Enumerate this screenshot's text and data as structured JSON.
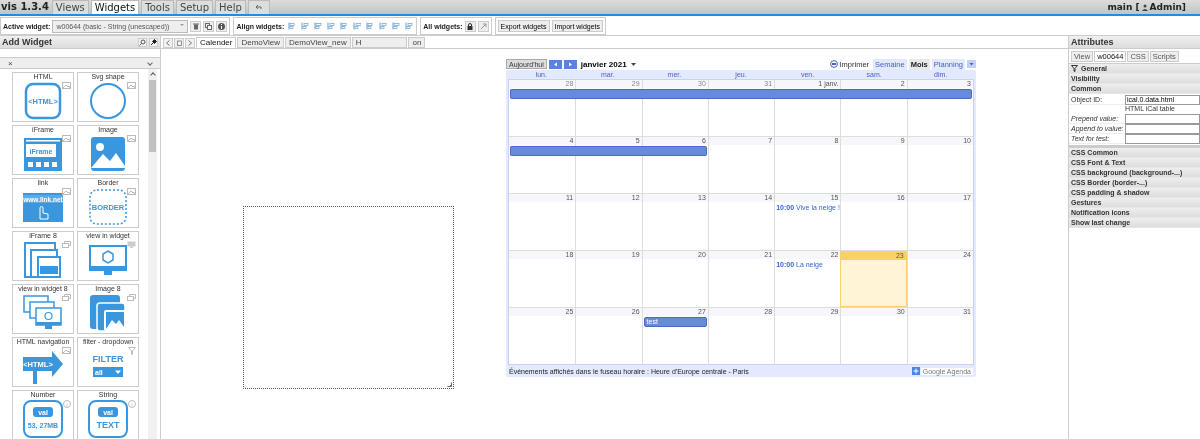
{
  "menubar": {
    "app_title": "vis 1.3.4",
    "menus": [
      {
        "label": "Views",
        "selected": false
      },
      {
        "label": "Widgets",
        "selected": true
      },
      {
        "label": "Tools",
        "selected": false
      },
      {
        "label": "Setup",
        "selected": false
      },
      {
        "label": "Help",
        "selected": false
      }
    ],
    "user_prefix": "main [",
    "user_name": "Admin]"
  },
  "toolbar": {
    "active_widget_label": "Active widget:",
    "active_widget": "w00644 (basic - String (unescaped))",
    "align_label": "Align widgets:",
    "all_label": "All widgets:",
    "buttons": [
      "Export widgets",
      "Import widgets"
    ]
  },
  "widget_panel": {
    "title": "Add Widget",
    "filter_clear": "×",
    "widgets": [
      {
        "name": "HTML",
        "kind": "html",
        "icon_texts": [
          "<HTML>"
        ]
      },
      {
        "name": "Svg shape",
        "kind": "svg"
      },
      {
        "name": "iFrame",
        "kind": "iframe",
        "icon_texts": [
          "iFrame"
        ]
      },
      {
        "name": "Image",
        "kind": "image"
      },
      {
        "name": "link",
        "kind": "link",
        "icon_texts": [
          "www.link.net"
        ]
      },
      {
        "name": "Border",
        "kind": "border",
        "icon_texts": [
          "BORDER"
        ]
      },
      {
        "name": "iFrame 8",
        "kind": "iframe8"
      },
      {
        "name": "view in widget",
        "kind": "view"
      },
      {
        "name": "view in widget 8",
        "kind": "view8"
      },
      {
        "name": "Image 8",
        "kind": "image8"
      },
      {
        "name": "HTML navigation",
        "kind": "navigation",
        "icon_texts": [
          "<HTML>"
        ]
      },
      {
        "name": "filter - dropdown",
        "kind": "filter",
        "icon_texts": [
          "FILTER",
          "all"
        ]
      },
      {
        "name": "Number",
        "kind": "number",
        "icon_texts": [
          "val",
          "53, 27MB"
        ]
      },
      {
        "name": "String",
        "kind": "string",
        "icon_texts": [
          "val",
          "TEXT"
        ]
      }
    ]
  },
  "view_tabs": [
    {
      "label": "Calender",
      "selected": true
    },
    {
      "label": "DemoView",
      "selected": false
    },
    {
      "label": "DemoView_new",
      "selected": false
    },
    {
      "label": "H",
      "selected": false
    },
    {
      "label": "on",
      "selected": false
    }
  ],
  "calendar": {
    "today_button": "Aujourd'hui",
    "month": "janvier 2021",
    "print": "Imprimer",
    "views": [
      {
        "label": "Semaine",
        "selected": false
      },
      {
        "label": "Mois",
        "selected": true
      },
      {
        "label": "Planning",
        "selected": false
      }
    ],
    "weekdays": [
      "lun.",
      "mar.",
      "mer.",
      "jeu.",
      "ven.",
      "sam.",
      "dim."
    ],
    "weeks": [
      {
        "days": [
          {
            "label": "28",
            "in_month": false,
            "today": false,
            "events": [
              {
                "kind": "bar",
                "joins_left": false,
                "joins_right": true
              }
            ]
          },
          {
            "label": "29",
            "in_month": false,
            "today": false,
            "events": [
              {
                "kind": "bar",
                "joins_left": true,
                "joins_right": true
              }
            ]
          },
          {
            "label": "30",
            "in_month": false,
            "today": false,
            "events": [
              {
                "kind": "bar",
                "joins_left": true,
                "joins_right": true
              }
            ]
          },
          {
            "label": "31",
            "in_month": false,
            "today": false,
            "events": [
              {
                "kind": "bar",
                "joins_left": true,
                "joins_right": true
              }
            ]
          },
          {
            "label": "1 janv.",
            "in_month": true,
            "today": false,
            "events": [
              {
                "kind": "bar",
                "joins_left": true,
                "joins_right": true
              }
            ]
          },
          {
            "label": "2",
            "in_month": true,
            "today": false,
            "events": [
              {
                "kind": "bar",
                "joins_left": true,
                "joins_right": true
              }
            ]
          },
          {
            "label": "3",
            "in_month": true,
            "today": false,
            "events": [
              {
                "kind": "bar",
                "joins_left": true,
                "joins_right": false
              }
            ]
          }
        ]
      },
      {
        "days": [
          {
            "label": "4",
            "in_month": true,
            "today": false,
            "events": [
              {
                "kind": "bar",
                "joins_left": false,
                "joins_right": true
              }
            ]
          },
          {
            "label": "5",
            "in_month": true,
            "today": false,
            "events": [
              {
                "kind": "bar",
                "joins_left": true,
                "joins_right": true
              }
            ]
          },
          {
            "label": "6",
            "in_month": true,
            "today": false,
            "events": [
              {
                "kind": "bar",
                "joins_left": true,
                "joins_right": false
              }
            ]
          },
          {
            "label": "7",
            "in_month": true,
            "today": false
          },
          {
            "label": "8",
            "in_month": true,
            "today": false
          },
          {
            "label": "9",
            "in_month": true,
            "today": false
          },
          {
            "label": "10",
            "in_month": true,
            "today": false
          }
        ]
      },
      {
        "days": [
          {
            "label": "11",
            "in_month": true,
            "today": false
          },
          {
            "label": "12",
            "in_month": true,
            "today": false
          },
          {
            "label": "13",
            "in_month": true,
            "today": false
          },
          {
            "label": "14",
            "in_month": true,
            "today": false
          },
          {
            "label": "15",
            "in_month": true,
            "today": false,
            "events": [
              {
                "kind": "timed",
                "time": "10:00",
                "title": "Vive la neige !"
              }
            ]
          },
          {
            "label": "16",
            "in_month": true,
            "today": false
          },
          {
            "label": "17",
            "in_month": true,
            "today": false
          }
        ]
      },
      {
        "days": [
          {
            "label": "18",
            "in_month": true,
            "today": false
          },
          {
            "label": "19",
            "in_month": true,
            "today": false
          },
          {
            "label": "20",
            "in_month": true,
            "today": false
          },
          {
            "label": "21",
            "in_month": true,
            "today": false
          },
          {
            "label": "22",
            "in_month": true,
            "today": false,
            "events": [
              {
                "kind": "timed",
                "time": "10:00",
                "title": "La neige"
              }
            ]
          },
          {
            "label": "23",
            "in_month": true,
            "today": true
          },
          {
            "label": "24",
            "in_month": true,
            "today": false
          }
        ]
      },
      {
        "days": [
          {
            "label": "25",
            "in_month": true,
            "today": false
          },
          {
            "label": "26",
            "in_month": true,
            "today": false
          },
          {
            "label": "27",
            "in_month": true,
            "today": false,
            "events": [
              {
                "kind": "bar",
                "joins_left": false,
                "joins_right": false,
                "title": "test"
              }
            ]
          },
          {
            "label": "28",
            "in_month": true,
            "today": false
          },
          {
            "label": "29",
            "in_month": true,
            "today": false
          },
          {
            "label": "30",
            "in_month": true,
            "today": false
          },
          {
            "label": "31",
            "in_month": true,
            "today": false
          }
        ]
      }
    ],
    "footer": "Événements affichés dans le fuseau horaire : Heure d'Europe centrale - Paris",
    "agenda_link": "Google Agenda"
  },
  "attributes": {
    "title": "Attributes",
    "tabs": [
      {
        "label": "View",
        "selected": false
      },
      {
        "label": "w00644",
        "selected": true
      },
      {
        "label": "CSS",
        "selected": false
      },
      {
        "label": "Scripts",
        "selected": false
      }
    ],
    "top_sections": [
      {
        "label": "General",
        "filter_icon": true
      },
      {
        "label": "Visibility",
        "filter_icon": false
      },
      {
        "label": "Common",
        "filter_icon": false
      }
    ],
    "fields": [
      {
        "label": "Object ID:",
        "italic": false,
        "value": "ical.0.data.html",
        "note": "HTML iCal table"
      },
      {
        "label": "Prepend value:",
        "italic": true
      },
      {
        "label": "Append to value:",
        "italic": true
      },
      {
        "label": "Text for test:",
        "italic": true
      }
    ],
    "css_sections": [
      "CSS Common",
      "CSS Font & Text",
      "CSS background (background-...)",
      "CSS Border (border-...)",
      "CSS padding & shadow",
      "Gestures",
      "Notification icons",
      "Show last change"
    ]
  }
}
